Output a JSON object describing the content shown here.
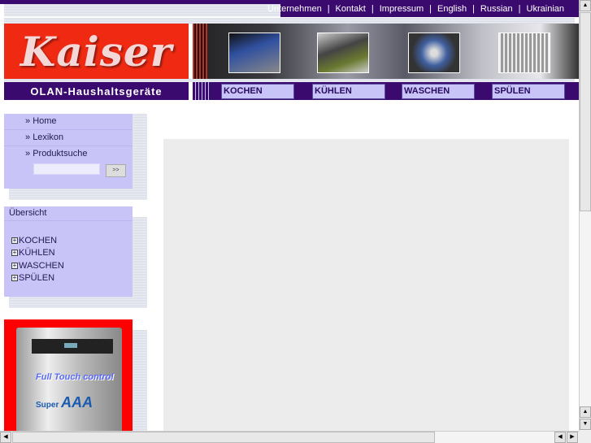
{
  "top_nav": [
    "Unternehmen",
    "Kontakt",
    "Impressum",
    "English",
    "Russian",
    "Ukrainian"
  ],
  "logo_text": "Kaiser",
  "tagline": "OLAN-Haushaltsgeräte",
  "categories": [
    "KOCHEN",
    "KÜHLEN",
    "WASCHEN",
    "SPÜLEN"
  ],
  "sidebar": {
    "menu": [
      {
        "label": "Home"
      },
      {
        "label": "Lexikon"
      },
      {
        "label": "Produktsuche"
      }
    ],
    "search_value": "",
    "search_button": ">>",
    "overview_title": "Übersicht",
    "tree": [
      "KOCHEN",
      "KÜHLEN",
      "WASCHEN",
      "SPÜLEN"
    ]
  },
  "ad": {
    "line1": "Full Touch control",
    "line2_prefix": "Super",
    "line2": "AAA"
  },
  "colors": {
    "brand_purple": "#3a0a6e",
    "lavender": "#c8c4f8",
    "red": "#f02a12"
  }
}
